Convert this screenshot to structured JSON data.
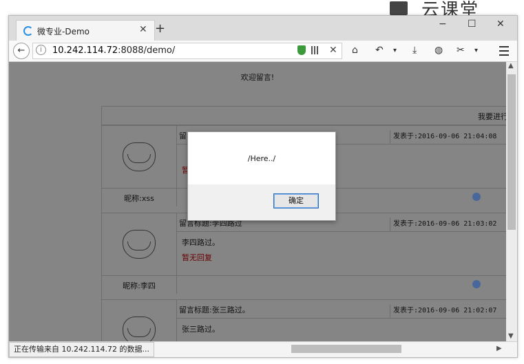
{
  "watermark": {
    "text": "云课堂"
  },
  "window": {
    "tab": {
      "title": "微专业-Demo",
      "close": "✕"
    },
    "new_tab": "+",
    "controls": {
      "minimize": "−",
      "maximize": "☐",
      "close": "✕"
    }
  },
  "nav": {
    "back": "←",
    "url_host": "10.242.114.72",
    "url_rest": ":8088/demo/",
    "stop": "✕",
    "home": "⌂",
    "undo": "↶"
  },
  "page": {
    "welcome": "欢迎留言!",
    "post_link": "我要进行",
    "messages": [
      {
        "title": "留",
        "time": "发表于:2016-09-06 21:04:08",
        "body": "",
        "reply": "暂",
        "nick": "昵称:xss"
      },
      {
        "title": "留言标题:李四路过",
        "time": "发表于:2016-09-06 21:03:02",
        "body": "李四路过。",
        "reply": "暂无回复",
        "nick": "昵称:李四"
      },
      {
        "title": "留言标题:张三路过。",
        "time": "发表于:2016-09-06 21:02:07",
        "body": "张三路过。",
        "reply": "",
        "nick": ""
      }
    ]
  },
  "status": {
    "text": "正在传输来自 10.242.114.72 的数据..."
  },
  "alert": {
    "message": "/Here../",
    "ok_label": "确定"
  }
}
